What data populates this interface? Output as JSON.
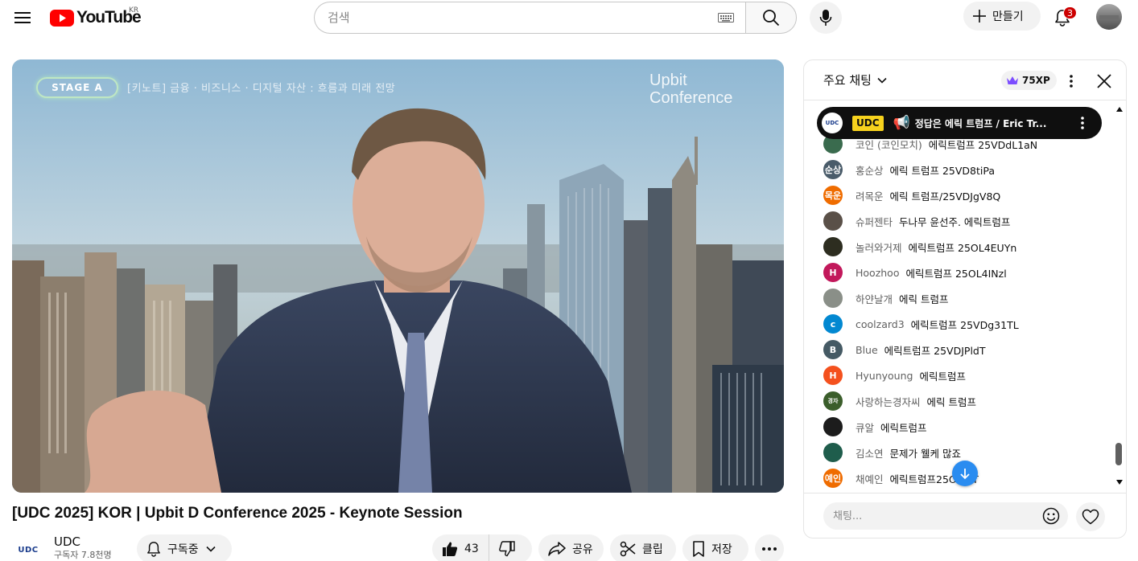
{
  "masthead": {
    "logo_text": "YouTube",
    "country_code": "KR",
    "search_placeholder": "검색",
    "create_label": "만들기",
    "notification_count": "3"
  },
  "player": {
    "stage_badge": "STAGE A",
    "session_caption": "[키노트] 금융 · 비즈니스 · 디지털 자산 : 흐름과 미래 전망",
    "logo_line1": "Upbit",
    "logo_line2": "Conference"
  },
  "video": {
    "title": "[UDC 2025] KOR | Upbit D Conference 2025 - Keynote Session",
    "channel_avatar_text": "UDC",
    "channel_name": "UDC",
    "subscribers": "구독자 7.8천명",
    "subscribe_label": "구독중",
    "like_count": "43",
    "share_label": "공유",
    "clip_label": "클립",
    "save_label": "저장"
  },
  "chat": {
    "mode_label": "주요 채팅",
    "xp_label": "75XP",
    "pinned": {
      "avatar_text": "UDC",
      "tag": "UDC",
      "icon": "📢",
      "text": "정답은 에릭 트럼프 / Eric Tr..."
    },
    "messages": [
      {
        "author": "코인 (코인모치)",
        "text": "에릭트럼프 25VDdL1aN",
        "avatar_text": "",
        "avatar_color": "#3a6b4e"
      },
      {
        "author": "홍순상",
        "text": "에릭 트럼프 25VD8tiPa",
        "avatar_text": "순상",
        "avatar_color": "#4a5c6a"
      },
      {
        "author": "려목운",
        "text": "에릭 트럼프/25VDJgV8Q",
        "avatar_text": "목운",
        "avatar_color": "#ef6c00"
      },
      {
        "author": "슈퍼젠타",
        "text": "두나무 윤선주. 에릭트럼프",
        "avatar_text": "",
        "avatar_color": "#5a5048"
      },
      {
        "author": "놀러와거제",
        "text": "에릭트럼프 25OL4EUYn",
        "avatar_text": "",
        "avatar_color": "#2d2d20"
      },
      {
        "author": "Hoozhoo",
        "text": "에릭트럼프 25OL4INzl",
        "avatar_text": "H",
        "avatar_color": "#c2185b"
      },
      {
        "author": "하얀날개",
        "text": "에릭 트럼프",
        "avatar_text": "",
        "avatar_color": "#8a8f88"
      },
      {
        "author": "coolzard3",
        "text": "에릭트럼프 25VDg31TL",
        "avatar_text": "c",
        "avatar_color": "#0288d1"
      },
      {
        "author": "Blue",
        "text": "에릭트럼프 25VDJPldT",
        "avatar_text": "B",
        "avatar_color": "#455a64"
      },
      {
        "author": "Hyunyoung",
        "text": "에릭트럼프",
        "avatar_text": "H",
        "avatar_color": "#f4511e"
      },
      {
        "author": "사랑하는경자씨",
        "text": "에릭 트럼프",
        "avatar_text": "경자",
        "avatar_color": "#3b5e2b"
      },
      {
        "author": "큐알",
        "text": "에릭트럼프",
        "avatar_text": "",
        "avatar_color": "#1c1c1c"
      },
      {
        "author": "김소연",
        "text": "문제가 웰케 많죠",
        "avatar_text": "",
        "avatar_color": "#1f5d4c"
      },
      {
        "author": "채예인",
        "text": "에릭트럼프25O...4T",
        "avatar_text": "예인",
        "avatar_color": "#ef6c00"
      }
    ],
    "input_placeholder": "채팅..."
  }
}
